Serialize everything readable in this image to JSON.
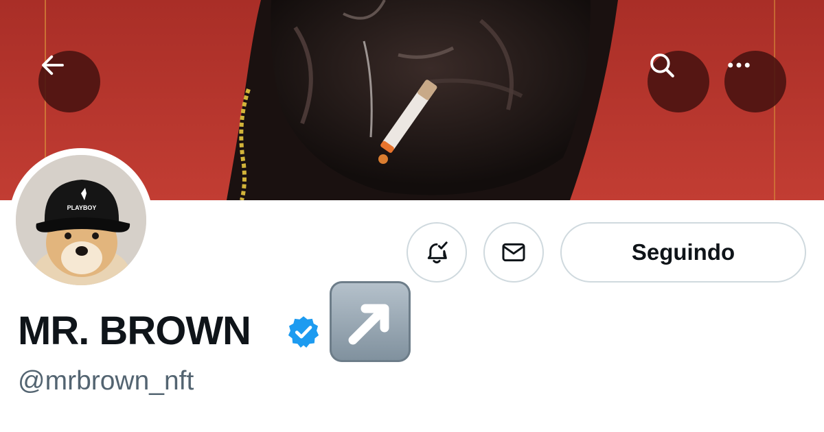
{
  "header": {
    "banner_color": "#b8352d",
    "back_icon": "arrow-left-icon",
    "search_icon": "search-icon",
    "more_icon": "more-horizontal-icon"
  },
  "profile": {
    "display_name": "MR. BROWN",
    "handle": "@mrbrown_nft",
    "verified": true,
    "verified_color": "#1d9bf0",
    "emoji_icon": "up-right-arrow-emoji-icon",
    "avatar_hat_text": "PLAYBOY"
  },
  "actions": {
    "notify_icon": "bell-check-icon",
    "message_icon": "envelope-icon",
    "follow_label": "Seguindo"
  }
}
